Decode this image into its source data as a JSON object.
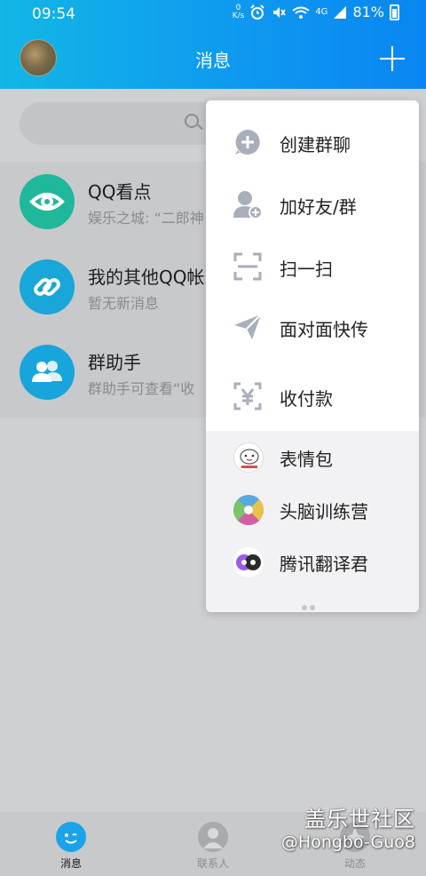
{
  "status_bar": {
    "time": "09:54",
    "net_speed_value": "0",
    "net_speed_unit": "K/s",
    "network_type": "4G",
    "battery": "81%"
  },
  "header": {
    "title": "消息"
  },
  "search": {
    "icon": "search-icon"
  },
  "conversations": [
    {
      "name": "QQ看点",
      "preview": "娱乐之城: “二郎神",
      "icon": "eye-icon",
      "color": "#1fb89a"
    },
    {
      "name": "我的其他QQ帐",
      "preview": "暂无新消息",
      "icon": "link-icon",
      "color": "#19a6d8"
    },
    {
      "name": "群助手",
      "preview": "群助手可查看“收",
      "icon": "group-icon",
      "color": "#17a5dc"
    }
  ],
  "menu": {
    "actions": [
      {
        "label": "创建群聊",
        "icon": "create-group-icon"
      },
      {
        "label": "加好友/群",
        "icon": "add-friend-icon"
      },
      {
        "label": "扫一扫",
        "icon": "scan-icon"
      },
      {
        "label": "面对面快传",
        "icon": "send-icon"
      },
      {
        "label": "收付款",
        "icon": "payment-icon"
      }
    ],
    "apps": [
      {
        "label": "表情包",
        "icon": "sticker-app-icon"
      },
      {
        "label": "头脑训练营",
        "icon": "brain-training-app-icon"
      },
      {
        "label": "腾讯翻译君",
        "icon": "translator-app-icon"
      }
    ]
  },
  "tabs": [
    {
      "label": "消息",
      "active": true
    },
    {
      "label": "联系人",
      "active": false
    },
    {
      "label": "动态",
      "active": false
    }
  ],
  "watermark": {
    "line1": "盖乐世社区",
    "line2": "@Hongbo-Guo8"
  },
  "colors": {
    "header_start": "#12b7e6",
    "header_end": "#0a86f2",
    "menu_icon": "#a9aebb"
  }
}
